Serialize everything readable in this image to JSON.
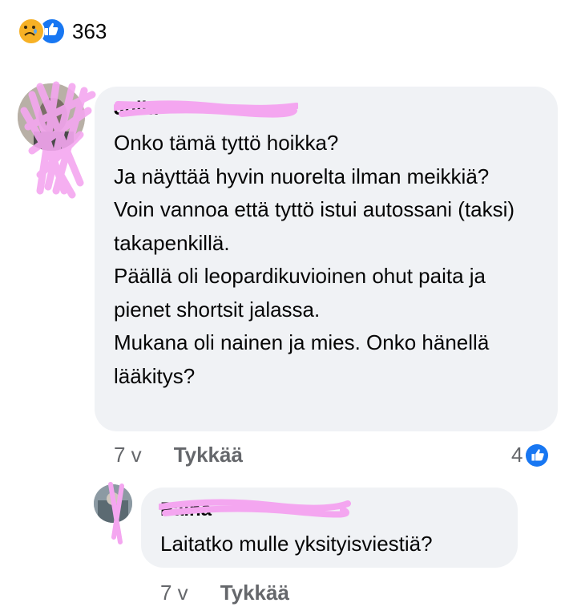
{
  "post_reactions": {
    "count": "363",
    "icons": [
      "sad-reaction-icon",
      "like-reaction-icon"
    ],
    "sad_color": "#f7b125",
    "like_color": "#1877f2"
  },
  "comments": [
    {
      "author": "Julia",
      "text": "Onko tämä tyttö hoikka?\nJa näyttää hyvin nuorelta ilman meikkiä?\nVoin vannoa että tyttö istui autossani (taksi) takapenkillä.\nPäällä oli leopardikuvioinen ohut paita ja pienet shortsit jalassa.\nMukana oli nainen ja mies. Onko hänellä lääkitys?",
      "time": "7 v",
      "like_label": "Tykkää",
      "reaction_count": "4"
    },
    {
      "author": "Paina",
      "text": "Laitatko mulle yksityisviestiä?",
      "time": "7 v",
      "like_label": "Tykkää"
    }
  ],
  "redaction_color": "#f4a6f0"
}
